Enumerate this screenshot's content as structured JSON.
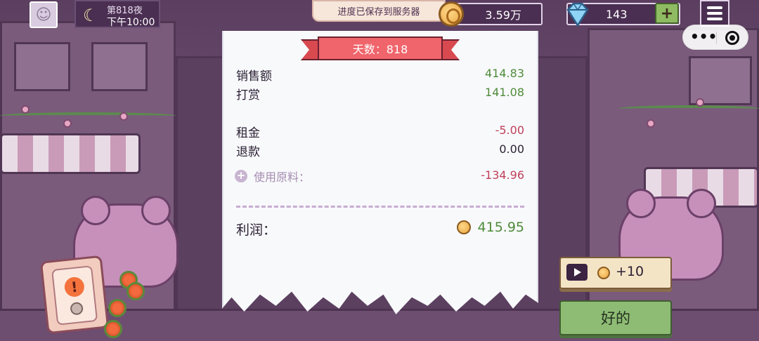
{
  "hud": {
    "night_label": "第818夜",
    "time_label": "下午10:00",
    "save_toast": "进度已保存到服务器",
    "coins": "3.59万",
    "gems": "143",
    "plus": "+",
    "capsule_more": "•••"
  },
  "receipt": {
    "day_banner": "天数：818",
    "sales_label": "销售额",
    "sales_value": "414.83",
    "tips_label": "打赏",
    "tips_value": "141.08",
    "rent_label": "租金",
    "rent_value": "-5.00",
    "refund_label": "退款",
    "refund_value": "0.00",
    "ingredients_label": "使用原料：",
    "ingredients_value": "-134.96",
    "profit_label": "利润：",
    "profit_value": "415.95"
  },
  "buttons": {
    "ad_reward": "+10",
    "ok": "好的"
  },
  "icons": {
    "avatar": "character-avatar-icon",
    "moon": "moon-icon",
    "coin": "coin-icon",
    "gem": "diamond-icon",
    "menu": "hamburger-menu-icon",
    "play": "video-play-icon",
    "alert": "exclamation-icon"
  },
  "colors": {
    "positive": "#4e8b3a",
    "negative": "#c0405a",
    "ribbon": "#f0646b",
    "ok_button": "#8ebc74"
  }
}
